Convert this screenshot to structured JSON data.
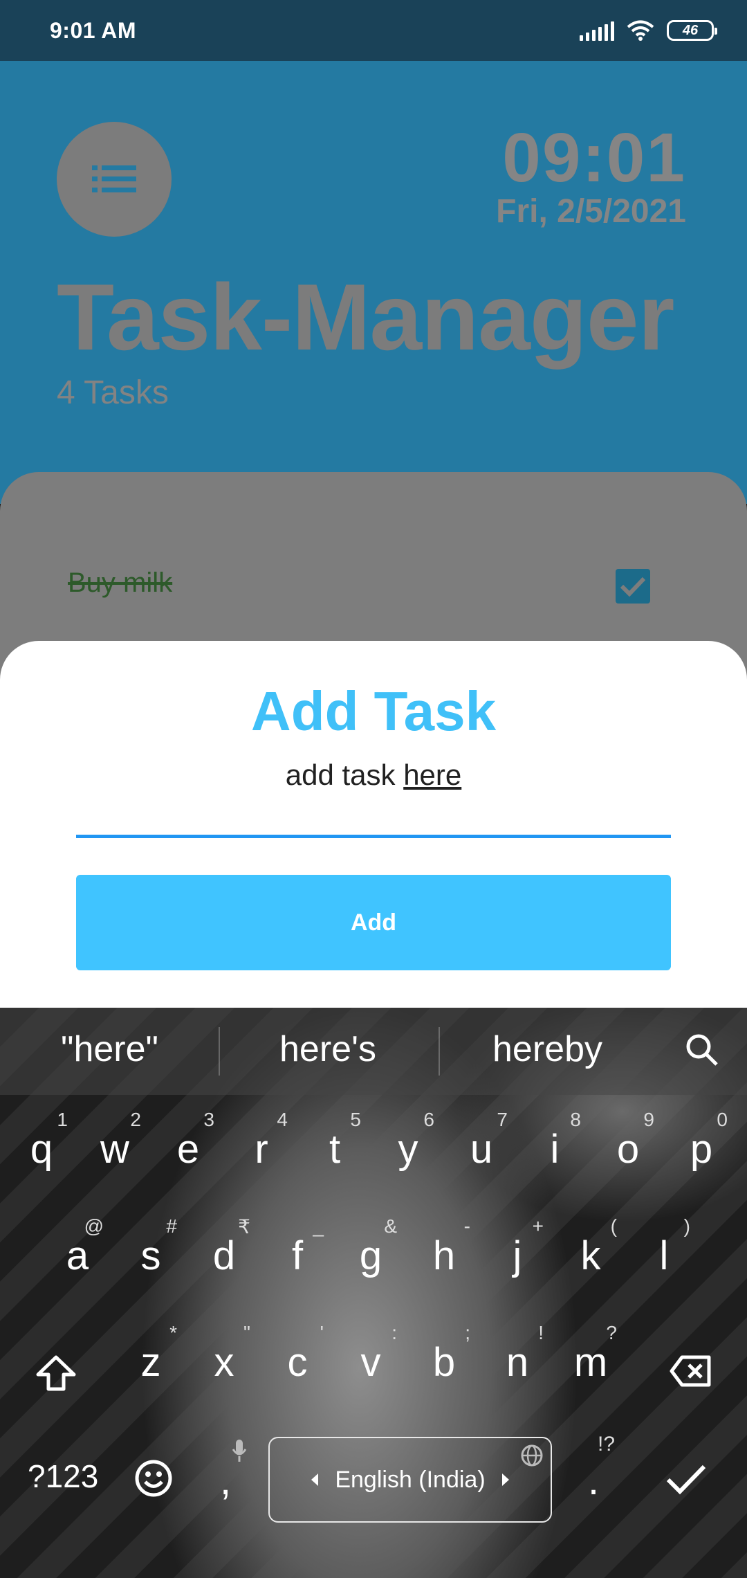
{
  "status_bar": {
    "time": "9:01 AM",
    "battery": "46"
  },
  "header": {
    "clock_time": "09:01",
    "date": "Fri, 2/5/2021",
    "app_title": "Task-Manager",
    "task_count": "4 Tasks"
  },
  "task_list": [
    {
      "label": "Buy milk",
      "completed": true
    }
  ],
  "dialog": {
    "title": "Add Task",
    "input_value_prefix": "add task ",
    "input_value_word": "here",
    "button_label": "Add"
  },
  "keyboard": {
    "suggestions": [
      "\"here\"",
      "here's",
      "hereby"
    ],
    "row1": [
      {
        "k": "q",
        "h": "1"
      },
      {
        "k": "w",
        "h": "2"
      },
      {
        "k": "e",
        "h": "3"
      },
      {
        "k": "r",
        "h": "4"
      },
      {
        "k": "t",
        "h": "5"
      },
      {
        "k": "y",
        "h": "6"
      },
      {
        "k": "u",
        "h": "7"
      },
      {
        "k": "i",
        "h": "8"
      },
      {
        "k": "o",
        "h": "9"
      },
      {
        "k": "p",
        "h": "0"
      }
    ],
    "row2": [
      {
        "k": "a",
        "h": "@"
      },
      {
        "k": "s",
        "h": "#"
      },
      {
        "k": "d",
        "h": "₹"
      },
      {
        "k": "f",
        "h": "_"
      },
      {
        "k": "g",
        "h": "&"
      },
      {
        "k": "h",
        "h": "-"
      },
      {
        "k": "j",
        "h": "+"
      },
      {
        "k": "k",
        "h": "("
      },
      {
        "k": "l",
        "h": ")"
      }
    ],
    "row3": [
      {
        "k": "z",
        "h": "*"
      },
      {
        "k": "x",
        "h": "\""
      },
      {
        "k": "c",
        "h": "'"
      },
      {
        "k": "v",
        "h": ":"
      },
      {
        "k": "b",
        "h": ";"
      },
      {
        "k": "n",
        "h": "!"
      },
      {
        "k": "m",
        "h": "?"
      }
    ],
    "symbols_key": "?123",
    "comma_key": ",",
    "space_label": "English (India)",
    "period_key": ".",
    "period_hint": "!?"
  },
  "colors": {
    "accent": "#40c4ff",
    "title_blue": "#40c0f8",
    "input_line": "#2196f3",
    "header_bg": "#247aa2",
    "status_bar_bg": "#1a4258"
  },
  "icons": {
    "menu": "list-icon",
    "check": "checkbox-checked-icon",
    "search": "search-icon",
    "shift": "shift-icon",
    "backspace": "backspace-icon",
    "emoji": "emoji-icon",
    "mic": "mic-icon",
    "globe": "globe-icon",
    "enter": "checkmark-icon"
  }
}
